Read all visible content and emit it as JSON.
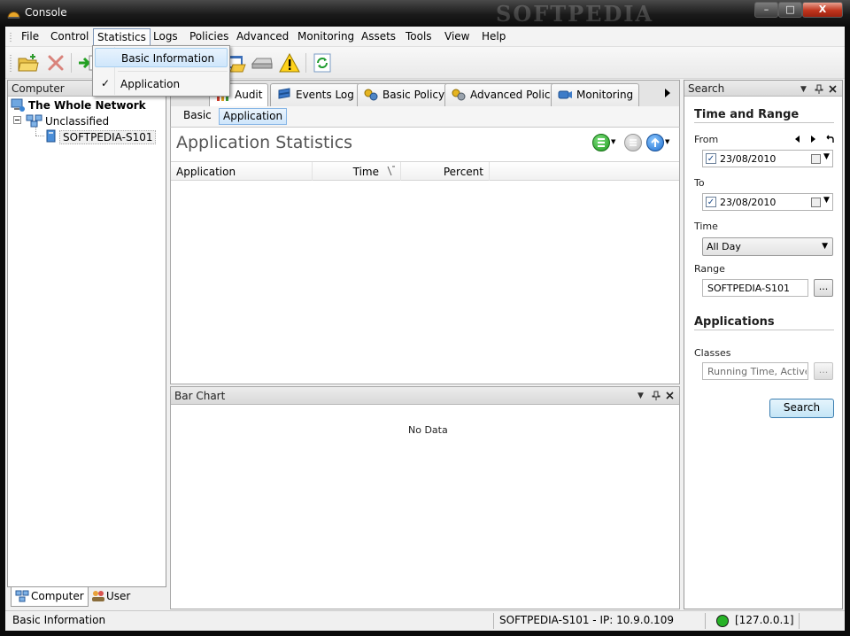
{
  "window": {
    "title": "Console",
    "watermark": "SOFTPEDIA",
    "controls": {
      "minimize": "–",
      "maximize": "□",
      "close": "X"
    }
  },
  "menubar": {
    "items": [
      "File",
      "Control",
      "Statistics",
      "Logs",
      "Policies",
      "Advanced",
      "Monitoring",
      "Assets",
      "Tools",
      "View",
      "Help"
    ],
    "open_item": "Statistics"
  },
  "statistics_menu": {
    "items": [
      {
        "label": "Basic Information",
        "highlighted": true,
        "checked": false
      },
      {
        "label": "Application",
        "highlighted": false,
        "checked": true
      }
    ],
    "check_glyph": "✓"
  },
  "toolbar": {
    "buttons": [
      "open-folder-icon",
      "delete-icon",
      "refresh-icon"
    ]
  },
  "left_panel": {
    "header": "Computer",
    "tree": [
      {
        "label": "The Whole Network",
        "bold": true,
        "level": 0
      },
      {
        "label": "Unclassified",
        "bold": false,
        "level": 1
      },
      {
        "label": "SOFTPEDIA-S101",
        "bold": false,
        "level": 2,
        "selected": true
      }
    ],
    "tabs": [
      "Computer",
      "User"
    ],
    "active_tab": "Computer"
  },
  "center": {
    "tabs": [
      "Audit",
      "Events Log",
      "Basic Policy",
      "Advanced Policy",
      "Monitoring"
    ],
    "active_tab": "Audit",
    "subtabs": [
      "Basic",
      "Application"
    ],
    "active_subtab": "Application",
    "stats": {
      "title": "Application Statistics",
      "columns": [
        "Application",
        "Time",
        "Percent"
      ],
      "rows": []
    },
    "bar_chart": {
      "header": "Bar Chart",
      "empty_text": "No Data"
    }
  },
  "search_panel": {
    "header": "Search",
    "time_and_range": {
      "title": "Time and Range",
      "from_label": "From",
      "from_value": "23/08/2010",
      "from_checked": true,
      "to_label": "To",
      "to_value": "23/08/2010",
      "to_checked": true,
      "time_label": "Time",
      "time_value": "All Day",
      "range_label": "Range",
      "range_value": "SOFTPEDIA-S101",
      "browse_label": "..."
    },
    "applications": {
      "title": "Applications",
      "classes_label": "Classes",
      "classes_value": "Running Time, Active Time",
      "browse_label": "..."
    },
    "search_button": "Search"
  },
  "statusbar": {
    "left": "Basic Information",
    "computer_info": "SOFTPEDIA-S101 - IP: 10.9.0.109",
    "server": "[127.0.0.1]",
    "connection_color": "#27b227"
  }
}
